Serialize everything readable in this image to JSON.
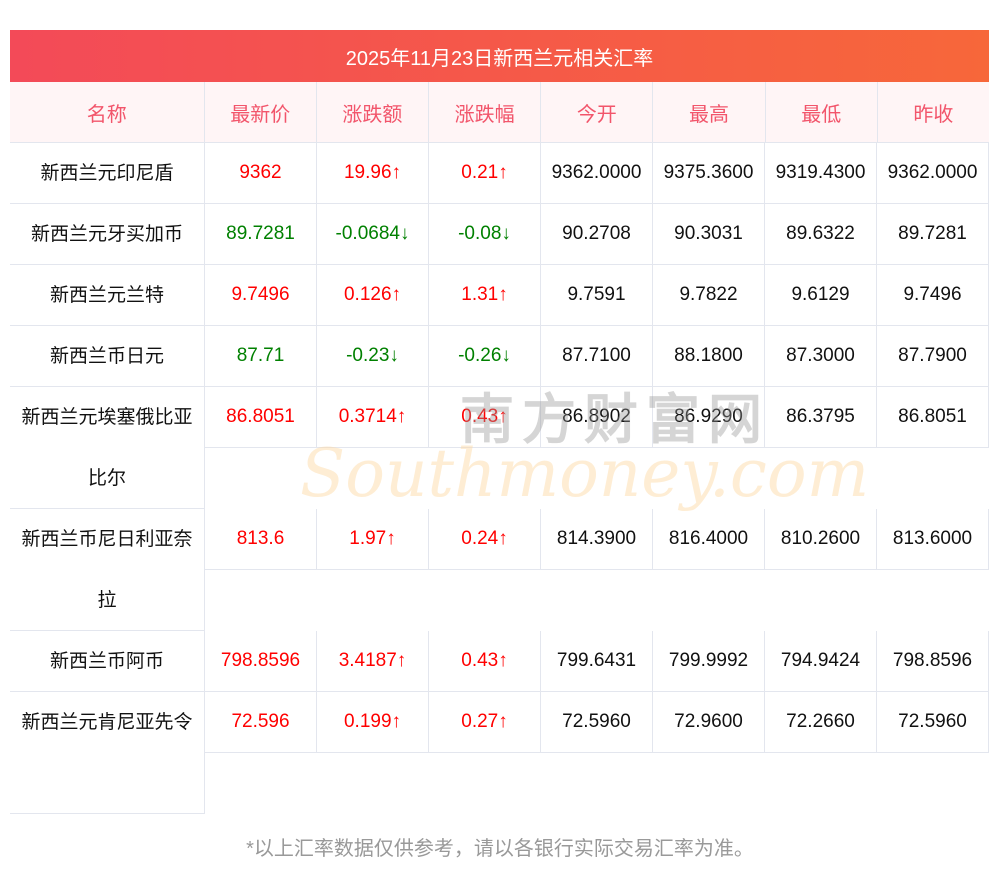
{
  "title": "2025年11月23日新西兰元相关汇率",
  "headers": [
    "名称",
    "最新价",
    "涨跌额",
    "涨跌幅",
    "今开",
    "最高",
    "最低",
    "昨收"
  ],
  "rows": [
    {
      "name": "新西兰元印尼盾",
      "lines": 1,
      "dir": "up",
      "latest": "9362",
      "change": "19.96↑",
      "pct": "0.21↑",
      "open": "9362.0000",
      "high": "9375.3600",
      "low": "9319.4300",
      "prev": "9362.0000"
    },
    {
      "name": "新西兰元牙买加币",
      "lines": 1,
      "dir": "down",
      "latest": "89.7281",
      "change": "-0.0684↓",
      "pct": "-0.08↓",
      "open": "90.2708",
      "high": "90.3031",
      "low": "89.6322",
      "prev": "89.7281"
    },
    {
      "name": "新西兰元兰特",
      "lines": 1,
      "dir": "up",
      "latest": "9.7496",
      "change": "0.126↑",
      "pct": "1.31↑",
      "open": "9.7591",
      "high": "9.7822",
      "low": "9.6129",
      "prev": "9.7496"
    },
    {
      "name": "新西兰币日元",
      "lines": 1,
      "dir": "down",
      "latest": "87.71",
      "change": "-0.23↓",
      "pct": "-0.26↓",
      "open": "87.7100",
      "high": "88.1800",
      "low": "87.3000",
      "prev": "87.7900"
    },
    {
      "name": "新西兰元埃塞俄比亚比尔",
      "lines": 2,
      "dir": "up",
      "latest": "86.8051",
      "change": "0.3714↑",
      "pct": "0.43↑",
      "open": "86.8902",
      "high": "86.9290",
      "low": "86.3795",
      "prev": "86.8051"
    },
    {
      "name": "新西兰币尼日利亚奈拉",
      "lines": 2,
      "dir": "up",
      "latest": "813.6",
      "change": "1.97↑",
      "pct": "0.24↑",
      "open": "814.3900",
      "high": "816.4000",
      "low": "810.2600",
      "prev": "813.6000"
    },
    {
      "name": "新西兰币阿币",
      "lines": 1,
      "dir": "up",
      "latest": "798.8596",
      "change": "3.4187↑",
      "pct": "0.43↑",
      "open": "799.6431",
      "high": "799.9992",
      "low": "794.9424",
      "prev": "798.8596"
    },
    {
      "name": "新西兰元肯尼亚先令",
      "lines": 2,
      "dir": "up",
      "latest": "72.596",
      "change": "0.199↑",
      "pct": "0.27↑",
      "open": "72.5960",
      "high": "72.9600",
      "low": "72.2660",
      "prev": "72.5960"
    }
  ],
  "watermark": {
    "cn": "南方财富网",
    "en": "Southmoney.com"
  },
  "note": "*以上汇率数据仅供参考，请以各银行实际交易汇率为准。",
  "colors": {
    "up": "#ff0000",
    "down": "#008000",
    "header": "#f2556b"
  }
}
